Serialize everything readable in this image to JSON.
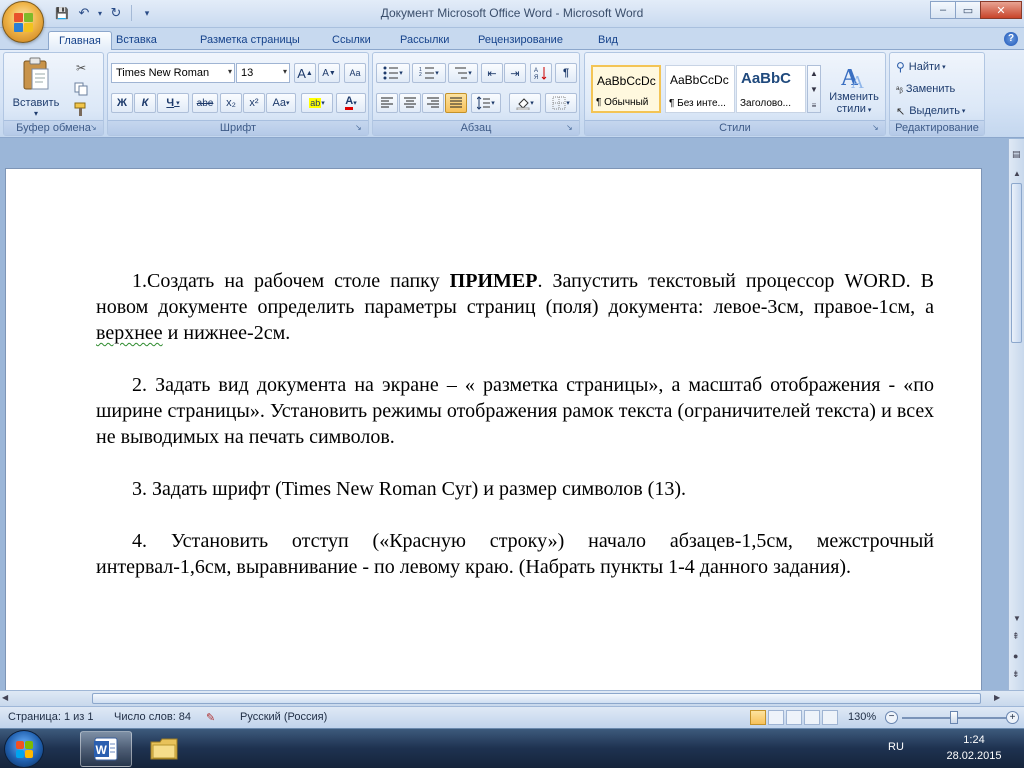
{
  "window": {
    "title": "Документ Microsoft Office Word - Microsoft Word",
    "controls": {
      "minimize": "–",
      "maximize": "▭",
      "close": "✕"
    }
  },
  "qat": {
    "save": "💾",
    "undo": "↶",
    "redo": "↻",
    "customize": "▾"
  },
  "tabs": [
    "Главная",
    "Вставка",
    "Разметка страницы",
    "Ссылки",
    "Рассылки",
    "Рецензирование",
    "Вид"
  ],
  "help": "?",
  "ribbon": {
    "clipboard": {
      "label": "Буфер обмена",
      "paste": "Вставить"
    },
    "font": {
      "label": "Шрифт",
      "name": "Times New Roman",
      "size": "13",
      "grow": "A",
      "shrink": "A",
      "clear": "Aa",
      "bold": "Ж",
      "italic": "К",
      "underline": "Ч",
      "strike": "abe",
      "subscript": "x₂",
      "superscript": "x²",
      "case": "Aa",
      "highlight": "ab",
      "color": "A"
    },
    "paragraph": {
      "label": "Абзац",
      "show_marks": "¶"
    },
    "styles": {
      "label": "Стили",
      "items": [
        {
          "preview": "AaBbCcDc",
          "name": "¶ Обычный"
        },
        {
          "preview": "AaBbCcDc",
          "name": "¶ Без инте..."
        },
        {
          "preview": "AaBbC",
          "name": "Заголово..."
        }
      ],
      "change": "Изменить",
      "change2": "стили"
    },
    "editing": {
      "label": "Редактирование",
      "find": "Найти",
      "replace": "Заменить",
      "select": "Выделить"
    }
  },
  "document": {
    "p1_a": "1.Создать на рабочем столе папку ",
    "p1_bold": "ПРИМЕР",
    "p1_b": ". Запустить текстовый процессор WORD. В новом документе определить параметры страниц (поля) документа: левое-3см, правое-1см, а ",
    "p1_squig": "верхнее",
    "p1_c": " и нижнее-2см.",
    "p2": "2. Задать вид документа на экране – « разметка страницы», а масштаб отображения - «по ширине страницы». Установить режимы отображения рамок текста (ограничителей текста) и всех не выводимых на печать символов.",
    "p3": "3. Задать шрифт (Times New Roman Cyr) и размер символов (13).",
    "p4": "4. Установить отступ («Красную строку») начало абзацев-1,5см, межстрочный интервал-1,6см, выравнивание - по левому краю. (Набрать пункты 1-4 данного задания)."
  },
  "status": {
    "page": "Страница: 1 из 1",
    "words": "Число слов: 84",
    "language": "Русский (Россия)",
    "zoom": "130%"
  },
  "taskbar": {
    "lang": "RU",
    "time": "1:24",
    "date": "28.02.2015"
  }
}
